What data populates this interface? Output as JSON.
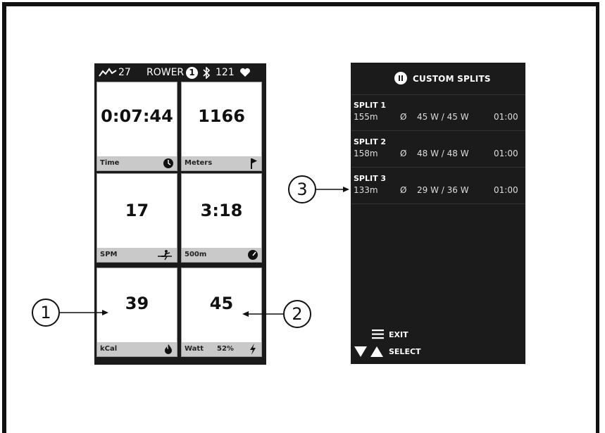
{
  "left_screen": {
    "status_bar": {
      "strokes": "27",
      "mode": "ROWER",
      "user_number": "1",
      "heart_rate": "121"
    },
    "tiles": [
      {
        "value": "0:07:44",
        "label": "Time",
        "icon": "clock-icon"
      },
      {
        "value": "1166",
        "label": "Meters",
        "icon": "flag-icon"
      },
      {
        "value": "17",
        "label": "SPM",
        "icon": "rower-icon"
      },
      {
        "value": "3:18",
        "label": "500m",
        "icon": "speedometer-icon"
      },
      {
        "value": "39",
        "label": "kCal",
        "icon": "flame-icon"
      },
      {
        "value": "45",
        "label": "Watt",
        "extra": "52%",
        "icon": "lightning-icon"
      }
    ]
  },
  "right_screen": {
    "title": "CUSTOM SPLITS",
    "splits": [
      {
        "name": "SPLIT 1",
        "distance": "155m",
        "symbol": "Ø",
        "watts": "45 W / 45 W",
        "time": "01:00"
      },
      {
        "name": "SPLIT 2",
        "distance": "158m",
        "symbol": "Ø",
        "watts": "48 W / 48 W",
        "time": "01:00"
      },
      {
        "name": "SPLIT 3",
        "distance": "133m",
        "symbol": "Ø",
        "watts": "29 W / 36 W",
        "time": "01:00"
      }
    ],
    "menu": {
      "exit": "EXIT",
      "select": "SELECT"
    }
  },
  "callouts": [
    "1",
    "2",
    "3"
  ],
  "colors": {
    "screen_bg": "#1a1a1a",
    "tile_label_bg": "#c9c9c9"
  }
}
